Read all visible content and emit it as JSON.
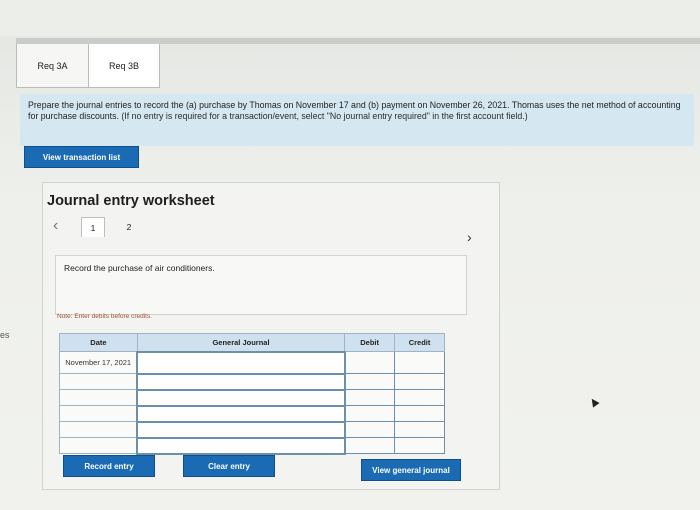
{
  "tabs": [
    {
      "label": "Req 3A"
    },
    {
      "label": "Req 3B"
    }
  ],
  "left_fragment": "es",
  "instruction": {
    "text": "Prepare the journal entries to record the (a) purchase by Thomas on November 17 and (b) payment on November 26, 2021. Thomas uses the net method of accounting for purchase discounts.",
    "note": "(If no entry is required for a transaction/event, select \"No journal entry required\" in the first account field.)"
  },
  "buttons": {
    "view_transaction_list": "View transaction list",
    "record_entry": "Record entry",
    "clear_entry": "Clear entry",
    "view_general_journal": "View general journal"
  },
  "worksheet": {
    "title": "Journal entry worksheet",
    "pages": [
      "1",
      "2"
    ],
    "prev_icon": "‹",
    "next_icon": "›",
    "description": "Record the purchase of air conditioners.",
    "note": "Note: Enter debits before credits."
  },
  "journal": {
    "headers": {
      "date": "Date",
      "account": "General Journal",
      "debit": "Debit",
      "credit": "Credit"
    },
    "rows": [
      {
        "date": "November 17, 2021"
      },
      {
        "date": ""
      },
      {
        "date": ""
      },
      {
        "date": ""
      },
      {
        "date": ""
      },
      {
        "date": ""
      }
    ]
  },
  "colors": {
    "accent": "#1a6ab4",
    "instruction_bg": "#d5e8f2",
    "table_header": "#cfe1ee"
  }
}
